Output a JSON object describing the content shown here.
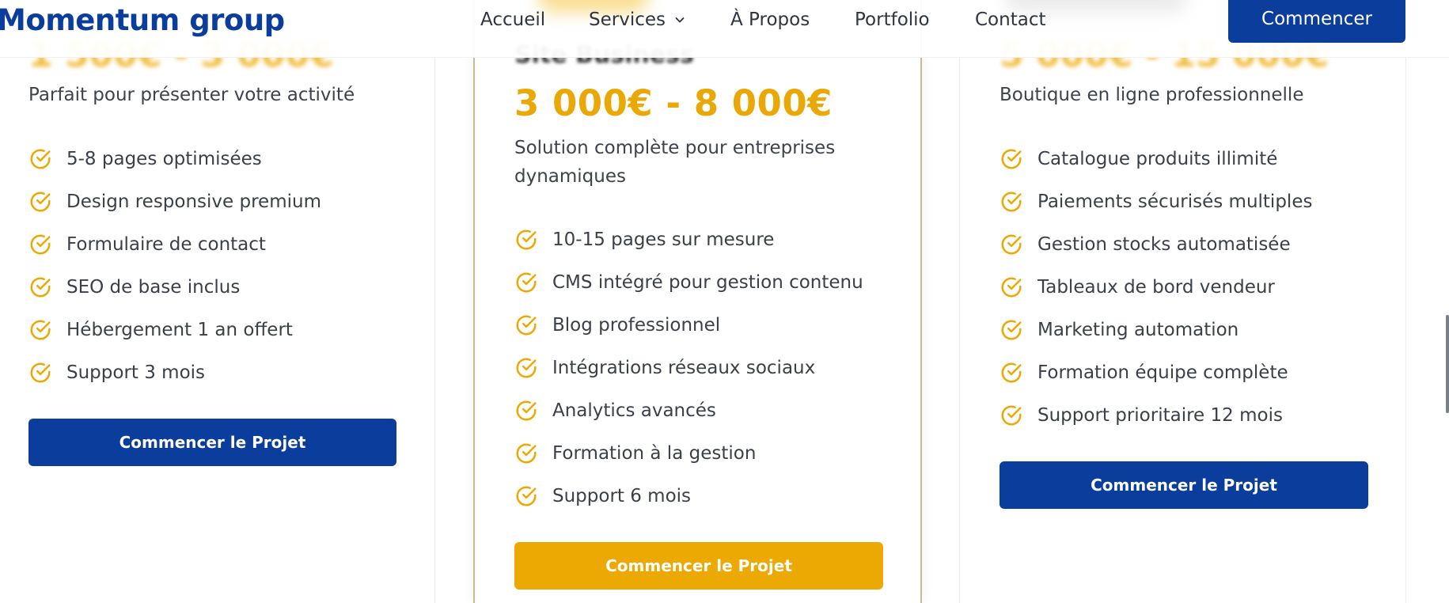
{
  "header": {
    "logo": "Momentum group",
    "nav": [
      "Accueil",
      "Services",
      "À Propos",
      "Portfolio",
      "Contact"
    ],
    "cta": "Commencer"
  },
  "colors": {
    "primary": "#0a3d9c",
    "accent": "#eca904",
    "text": "#3a3f49"
  },
  "plans": [
    {
      "price_partial": "1 500€ - 3 000€",
      "description": "Parfait pour présenter votre activité",
      "features": [
        "5-8 pages optimisées",
        "Design responsive premium",
        "Formulaire de contact",
        "SEO de base inclus",
        "Hébergement 1 an offert",
        "Support 3 mois"
      ],
      "cta": "Commencer le Projet"
    },
    {
      "name_partial": "Site Business",
      "price": "3 000€ - 8 000€",
      "description": "Solution complète pour entreprises dynamiques",
      "features": [
        "10-15 pages sur mesure",
        "CMS intégré pour gestion contenu",
        "Blog professionnel",
        "Intégrations réseaux sociaux",
        "Analytics avancés",
        "Formation à la gestion",
        "Support 6 mois"
      ],
      "cta": "Commencer le Projet"
    },
    {
      "price_partial": "5 000€ - 15 000€",
      "description": "Boutique en ligne professionnelle",
      "features": [
        "Catalogue produits illimité",
        "Paiements sécurisés multiples",
        "Gestion stocks automatisée",
        "Tableaux de bord vendeur",
        "Marketing automation",
        "Formation équipe complète",
        "Support prioritaire 12 mois"
      ],
      "cta": "Commencer le Projet"
    }
  ],
  "icons": {
    "feature": "check-circle-icon",
    "dropdown": "chevron-down-icon"
  }
}
